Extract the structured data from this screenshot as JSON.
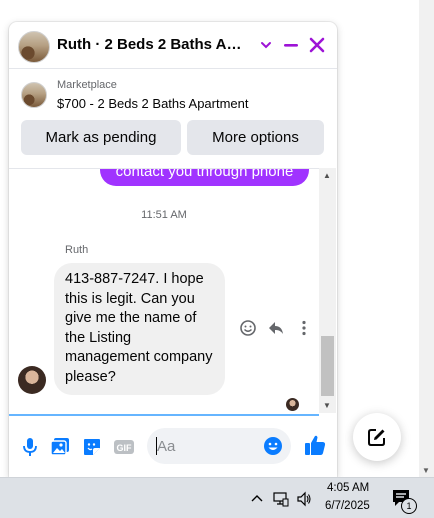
{
  "header": {
    "title": "Ruth · 2 Beds 2 Baths Apar…"
  },
  "listing": {
    "source": "Marketplace",
    "title": "$700 - 2 Beds 2 Baths Apartment"
  },
  "actions": {
    "pending_label": "Mark as pending",
    "more_label": "More options"
  },
  "thread": {
    "sent_partial": "contact you through phone",
    "timestamp": "11:51 AM",
    "sender_name": "Ruth",
    "message": "413-887-7247. I hope this is legit. Can you give me the name of the Listing management company please?"
  },
  "composer": {
    "placeholder": "Aa",
    "gif_label": "GIF"
  },
  "taskbar": {
    "time": "4:05 AM",
    "date": "6/7/2025",
    "notification_count": "1"
  },
  "colors": {
    "accent": "#9d13d6",
    "sent_bubble": "#a033ff",
    "messenger_blue": "#0a7cff"
  }
}
